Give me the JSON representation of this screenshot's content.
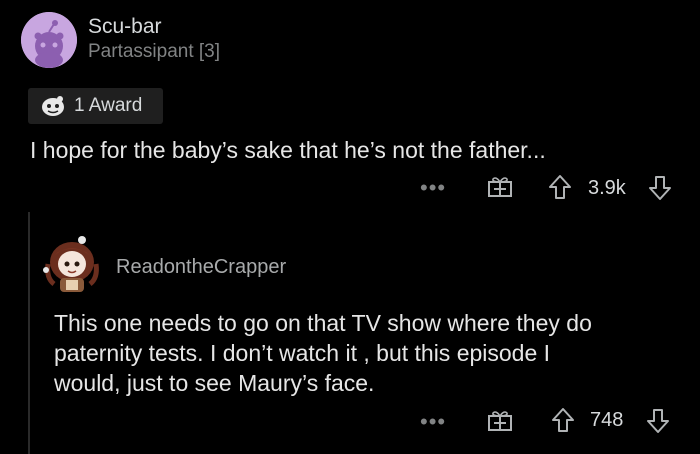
{
  "comment": {
    "username": "Scu-bar",
    "flair": "Partassipant [3]",
    "award_label": "1 Award",
    "body": "I hope for the baby’s sake that he’s not the father...",
    "more_label": "•••",
    "votes": "3.9k"
  },
  "reply": {
    "username": "ReadontheCrapper",
    "body_lines": [
      "This one needs to go on that TV show where they do",
      "paternity tests. I don’t watch it , but this episode I",
      "would, just to see Maury’s face."
    ],
    "more_label": "•••",
    "votes": "748"
  },
  "colors": {
    "background": "#000000",
    "text_primary": "#d7dadc",
    "text_muted": "#818384",
    "avatar_bg": "#c8a6e0"
  },
  "icons": [
    "snoo-avatar-icon",
    "award-icon",
    "more-icon",
    "gift-icon",
    "upvote-icon",
    "downvote-icon",
    "anime-avatar-icon"
  ]
}
